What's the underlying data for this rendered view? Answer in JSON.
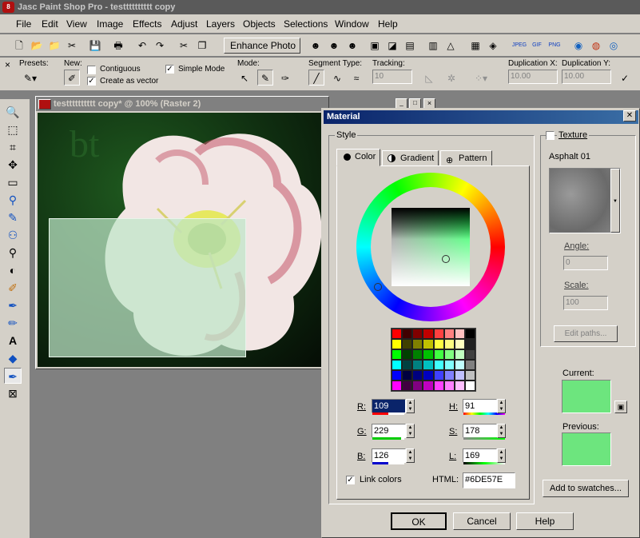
{
  "app": {
    "title": "Jasc Paint Shop Pro - testttttttttt copy",
    "icon_text": "8"
  },
  "menu": [
    "File",
    "Edit",
    "View",
    "Image",
    "Effects",
    "Adjust",
    "Layers",
    "Objects",
    "Selections",
    "Window",
    "Help"
  ],
  "toolbar": {
    "enhance_label": "Enhance Photo ▾"
  },
  "options": {
    "presets_label": "Presets:",
    "new_label": "New:",
    "contiguous_label": "Contiguous",
    "create_vector_label": "Create as vector",
    "simple_mode_label": "Simple Mode",
    "mode_label": "Mode:",
    "segment_label": "Segment Type:",
    "tracking_label": "Tracking:",
    "dupx_label": "Duplication X:",
    "dupy_label": "Duplication Y:",
    "tracking_value": "10",
    "dupx_value": "10.00",
    "dupy_value": "10.00",
    "create_vector_checked": "✓",
    "simple_mode_checked": "✓"
  },
  "document": {
    "title": "testttttttttt copy* @ 100% (Raster 2)"
  },
  "dialog": {
    "title": "Material",
    "style_label": "Style",
    "texture_label": "Texture",
    "texture_name": "Asphalt 01",
    "tabs": [
      "Color",
      "Gradient",
      "Pattern"
    ],
    "angle_label": "Angle:",
    "angle_value": "0",
    "scale_label": "Scale:",
    "scale_value": "100",
    "edit_paths_label": "Edit paths...",
    "current_label": "Current:",
    "previous_label": "Previous:",
    "add_swatches_label": "Add to swatches...",
    "r_label": "R:",
    "r_value": "109",
    "g_label": "G:",
    "g_value": "229",
    "b_label": "B:",
    "b_value": "126",
    "h_label": "H:",
    "h_value": "91",
    "s_label": "S:",
    "s_value": "178",
    "l_label": "L:",
    "l_value": "169",
    "link_label": "Link colors",
    "link_checked": "✓",
    "html_label": "HTML:",
    "html_value": "#6DE57E",
    "ok_label": "OK",
    "cancel_label": "Cancel",
    "help_label": "Help",
    "close_glyph": "✕",
    "current_color": "#6DE57E",
    "previous_color": "#6DE57E"
  },
  "swatch_colors": [
    "#ff0000",
    "#400000",
    "#800000",
    "#c00000",
    "#ff4040",
    "#ff8080",
    "#ffc0c0",
    "#000000",
    "#ffff00",
    "#404000",
    "#808000",
    "#c0c000",
    "#ffff40",
    "#ffff80",
    "#ffffc0",
    "#202020",
    "#00ff00",
    "#004000",
    "#008000",
    "#00c000",
    "#40ff40",
    "#80ff80",
    "#c0ffc0",
    "#404040",
    "#00ffff",
    "#004040",
    "#008080",
    "#00c0c0",
    "#40ffff",
    "#80ffff",
    "#c0ffff",
    "#808080",
    "#0000ff",
    "#000040",
    "#000080",
    "#0000c0",
    "#4040ff",
    "#8080ff",
    "#c0c0ff",
    "#c0c0c0",
    "#ff00ff",
    "#400040",
    "#800080",
    "#c000c0",
    "#ff40ff",
    "#ff80ff",
    "#ffc0ff",
    "#ffffff"
  ]
}
